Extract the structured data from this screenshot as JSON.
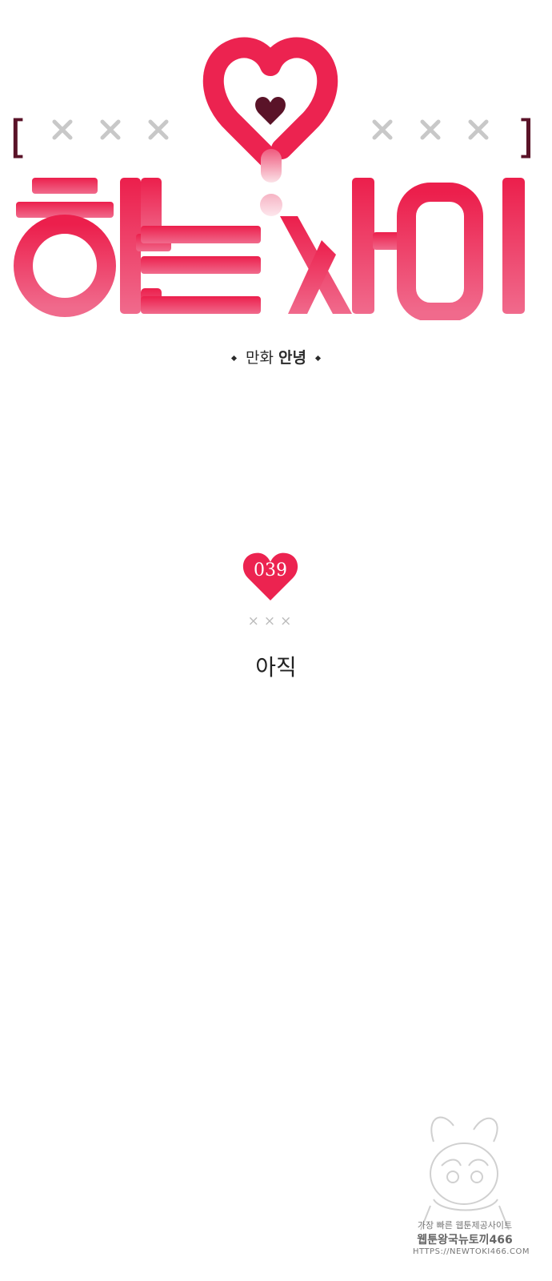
{
  "logo": {
    "bracket_left": "[",
    "bracket_right": "]",
    "title": "하는사이",
    "x_marks_left": "× × ×",
    "x_marks_right": "× × ×"
  },
  "credit": {
    "label": "만화",
    "author": "안녕"
  },
  "episode": {
    "number": "039",
    "x_marks": "×××",
    "title": "아직"
  },
  "watermark": {
    "line1": "가장 빠른 웹툰제공사이트",
    "line2": "웹툰왕국뉴토끼466",
    "line3": "HTTPS://NEWTOKI466.COM"
  },
  "colors": {
    "brand_pink": "#ec2350",
    "light_pink": "#f3a6b6",
    "dark_maroon": "#5a1328",
    "gray_x": "#c8c8c8"
  }
}
